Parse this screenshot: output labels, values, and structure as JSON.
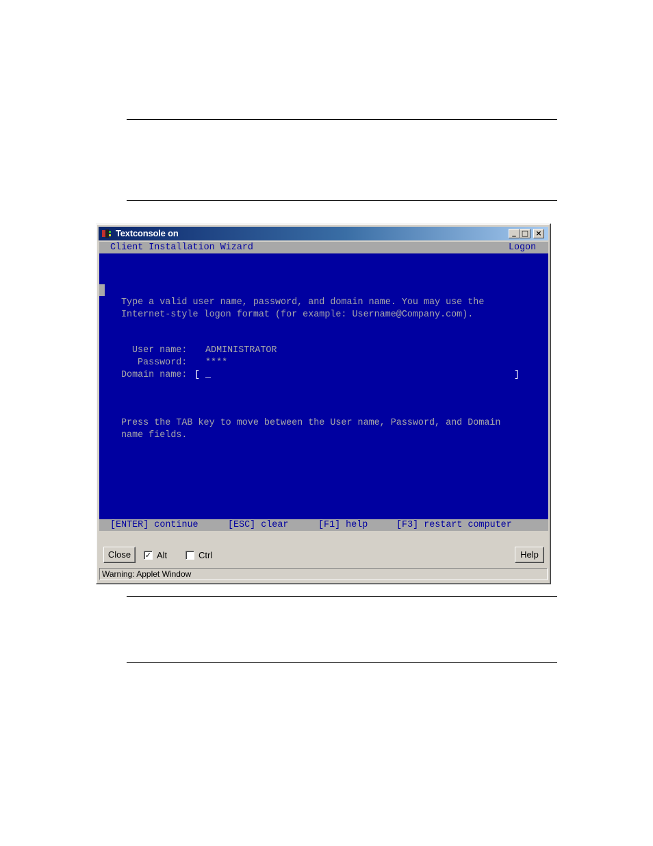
{
  "window": {
    "title": "Textconsole on",
    "minimize_glyph": "_",
    "maximize_glyph": "□",
    "close_glyph": "×"
  },
  "console": {
    "header_left": "Client Installation Wizard",
    "header_right": "Logon",
    "instruction_line1": "Type a valid user name, password, and domain name. You may use the",
    "instruction_line2": "Internet-style logon format (for example: Username@Company.com).",
    "user_label": "User name:",
    "user_value": "ADMINISTRATOR",
    "password_label": "Password:",
    "password_value": "****",
    "domain_label": "Domain name:",
    "domain_open": "[",
    "domain_value": "_",
    "domain_close": "]",
    "tab_line1": "Press the TAB key to move between the User name, Password, and Domain",
    "tab_line2": "name fields.",
    "footer_keys": [
      {
        "label": "[ENTER] continue"
      },
      {
        "label": "[ESC] clear"
      },
      {
        "label": "[F1] help"
      },
      {
        "label": "[F3] restart computer"
      }
    ]
  },
  "controls": {
    "close_label": "Close",
    "alt_label": "Alt",
    "alt_checked": true,
    "ctrl_label": "Ctrl",
    "ctrl_checked": false,
    "help_label": "Help",
    "check_glyph": "✓"
  },
  "status": {
    "text": "Warning: Applet Window"
  },
  "colors": {
    "console_bg": "#0000a0",
    "console_fg": "#a8a8a8",
    "title_start": "#0a246a",
    "title_end": "#a6caf0",
    "face": "#d4d0c8"
  }
}
